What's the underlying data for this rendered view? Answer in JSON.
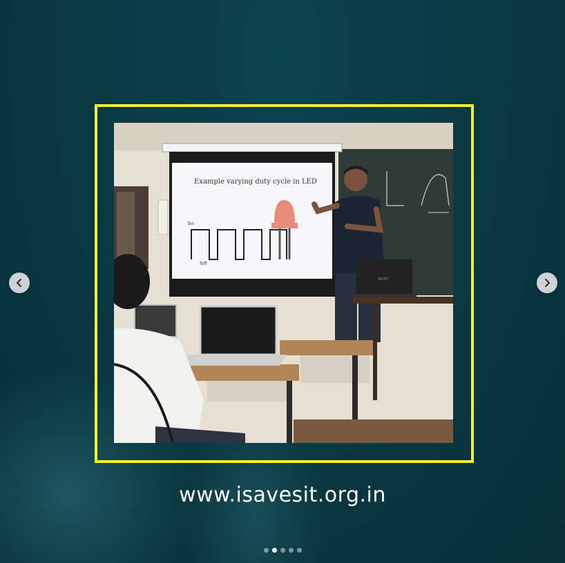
{
  "carousel": {
    "website_url": "www.isavesit.org.in",
    "slide_count": 5,
    "active_index": 1,
    "prev_icon": "chevron-left-icon",
    "next_icon": "chevron-right-icon"
  },
  "photo": {
    "slide_title": "Example varying duty cycle in LED",
    "ton_label": "Ton",
    "toff_label": "Toff",
    "laptop_brand": "acer"
  },
  "colors": {
    "frame_border": "#f4f32a",
    "background": "#0a3a45",
    "led": "#e88c7a"
  }
}
